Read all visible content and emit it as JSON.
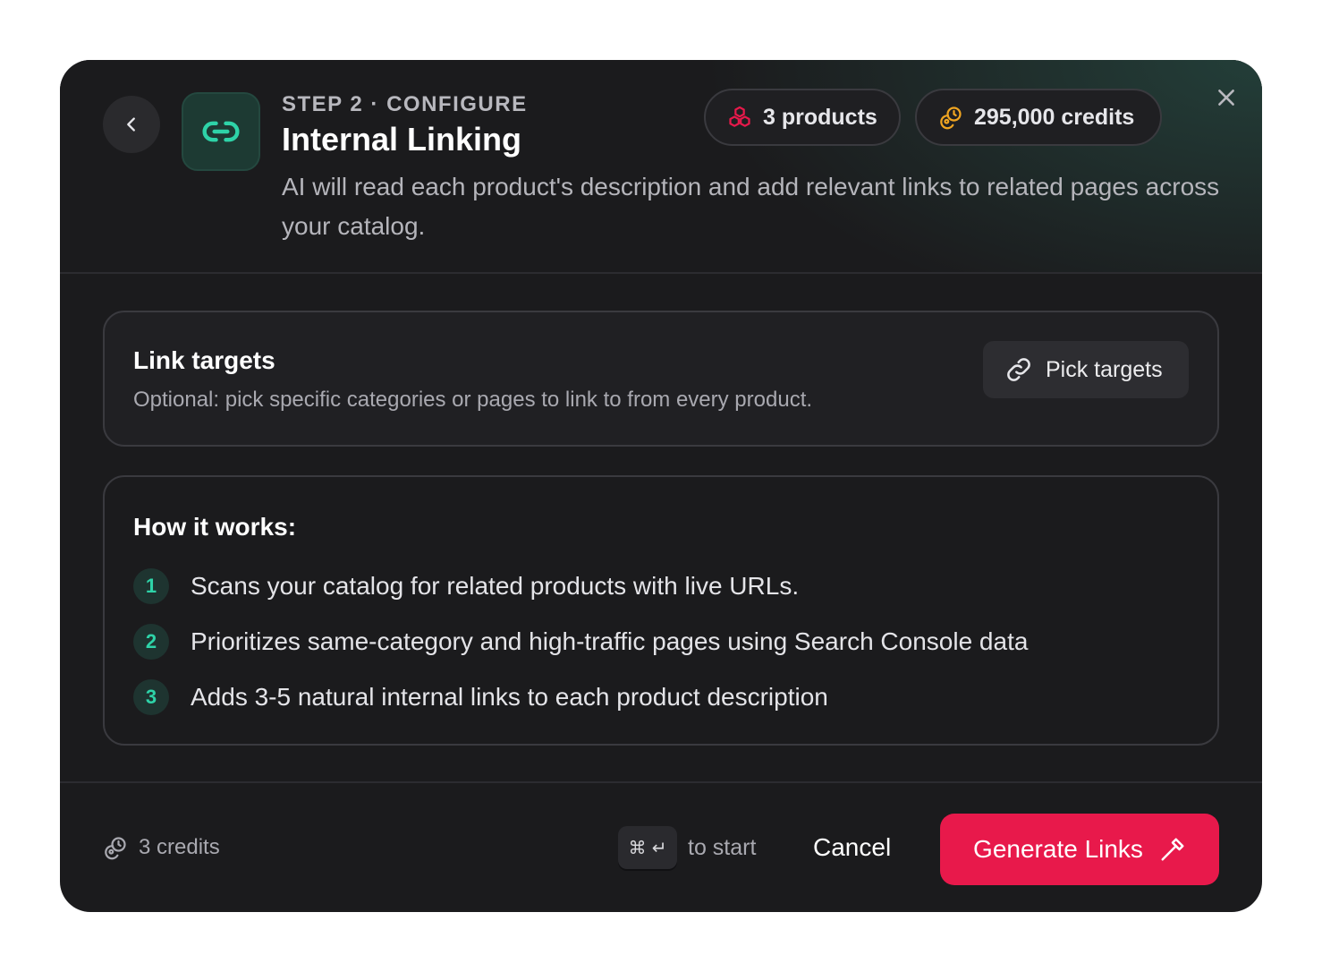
{
  "header": {
    "step_label": "STEP 2 · CONFIGURE",
    "title": "Internal Linking",
    "description": "AI will read each product's description and add relevant links to related pages across your catalog.",
    "products_pill": "3 products",
    "credits_pill": "295,000 credits"
  },
  "link_targets": {
    "title": "Link targets",
    "subtitle": "Optional: pick specific categories or pages to link to from every product.",
    "button_label": "Pick targets"
  },
  "how_it_works": {
    "title": "How it works:",
    "steps": [
      {
        "number": "1",
        "text": "Scans your catalog for related products with live URLs."
      },
      {
        "number": "2",
        "text": "Prioritizes same-category and high-traffic pages using Search Console data"
      },
      {
        "number": "3",
        "text": "Adds 3-5 natural internal links to each product description"
      }
    ]
  },
  "footer": {
    "cost_label": "3 credits",
    "shortcut_keys": "⌘ ↵",
    "shortcut_hint": "to start",
    "cancel_label": "Cancel",
    "generate_label": "Generate Links"
  },
  "colors": {
    "accent": "#e8194b",
    "teal": "#2ed3a8",
    "products_icon": "#e8194b",
    "credits_icon": "#f0a521"
  },
  "icons": {
    "back": "chevron-left-icon",
    "tool": "link-icon",
    "products": "cubes-icon",
    "credits": "coins-icon",
    "close": "close-icon",
    "pick": "link-icon",
    "generate": "wand-icon"
  }
}
